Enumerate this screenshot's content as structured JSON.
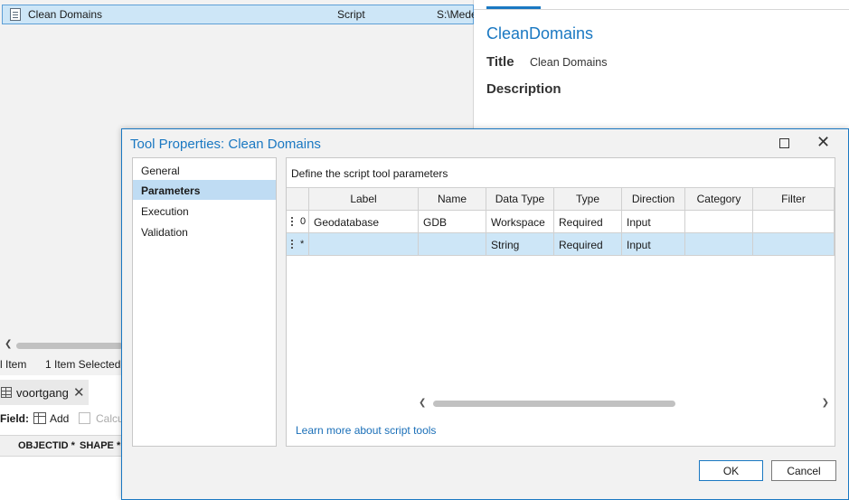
{
  "catalog": {
    "selected_item": {
      "name": "Clean Domains",
      "type": "Script",
      "path": "S:\\Mede"
    },
    "status": {
      "count": "l Item",
      "selected": "1 Item Selected"
    }
  },
  "attribute_table": {
    "tab_name": "voortgang",
    "close_glyph": "✕",
    "field_label": "Field:",
    "add_label": "Add",
    "calculate_label": "Calcu",
    "columns": [
      "OBJECTID *",
      "SHAPE *"
    ]
  },
  "metadata": {
    "name": "CleanDomains",
    "title_label": "Title",
    "title_value": "Clean Domains",
    "description_label": "Description"
  },
  "dialog": {
    "title": "Tool Properties: Clean Domains",
    "close_glyph": "✕",
    "nav": [
      "General",
      "Parameters",
      "Execution",
      "Validation"
    ],
    "nav_selected": "Parameters",
    "heading": "Define the script tool parameters",
    "columns": [
      "Label",
      "Name",
      "Data Type",
      "Type",
      "Direction",
      "Category",
      "Filter"
    ],
    "rows": [
      {
        "index": "0",
        "label": "Geodatabase",
        "name": "GDB",
        "data_type": "Workspace",
        "type": "Required",
        "direction": "Input",
        "category": "",
        "filter": ""
      },
      {
        "index": "*",
        "label": "",
        "name": "",
        "data_type": "String",
        "type": "Required",
        "direction": "Input",
        "category": "",
        "filter": ""
      }
    ],
    "learn_more": "Learn more about script tools",
    "ok_label": "OK",
    "cancel_label": "Cancel"
  },
  "colors": {
    "accent": "#1a78c2",
    "selection": "#cde6f7",
    "nav_selection": "#bfdcf3"
  },
  "icons": [
    "script-icon",
    "table-icon",
    "add-field-icon",
    "calculate-field-icon",
    "maximize-icon",
    "close-icon",
    "drag-handle-icon",
    "scroll-left-icon",
    "scroll-right-icon"
  ]
}
